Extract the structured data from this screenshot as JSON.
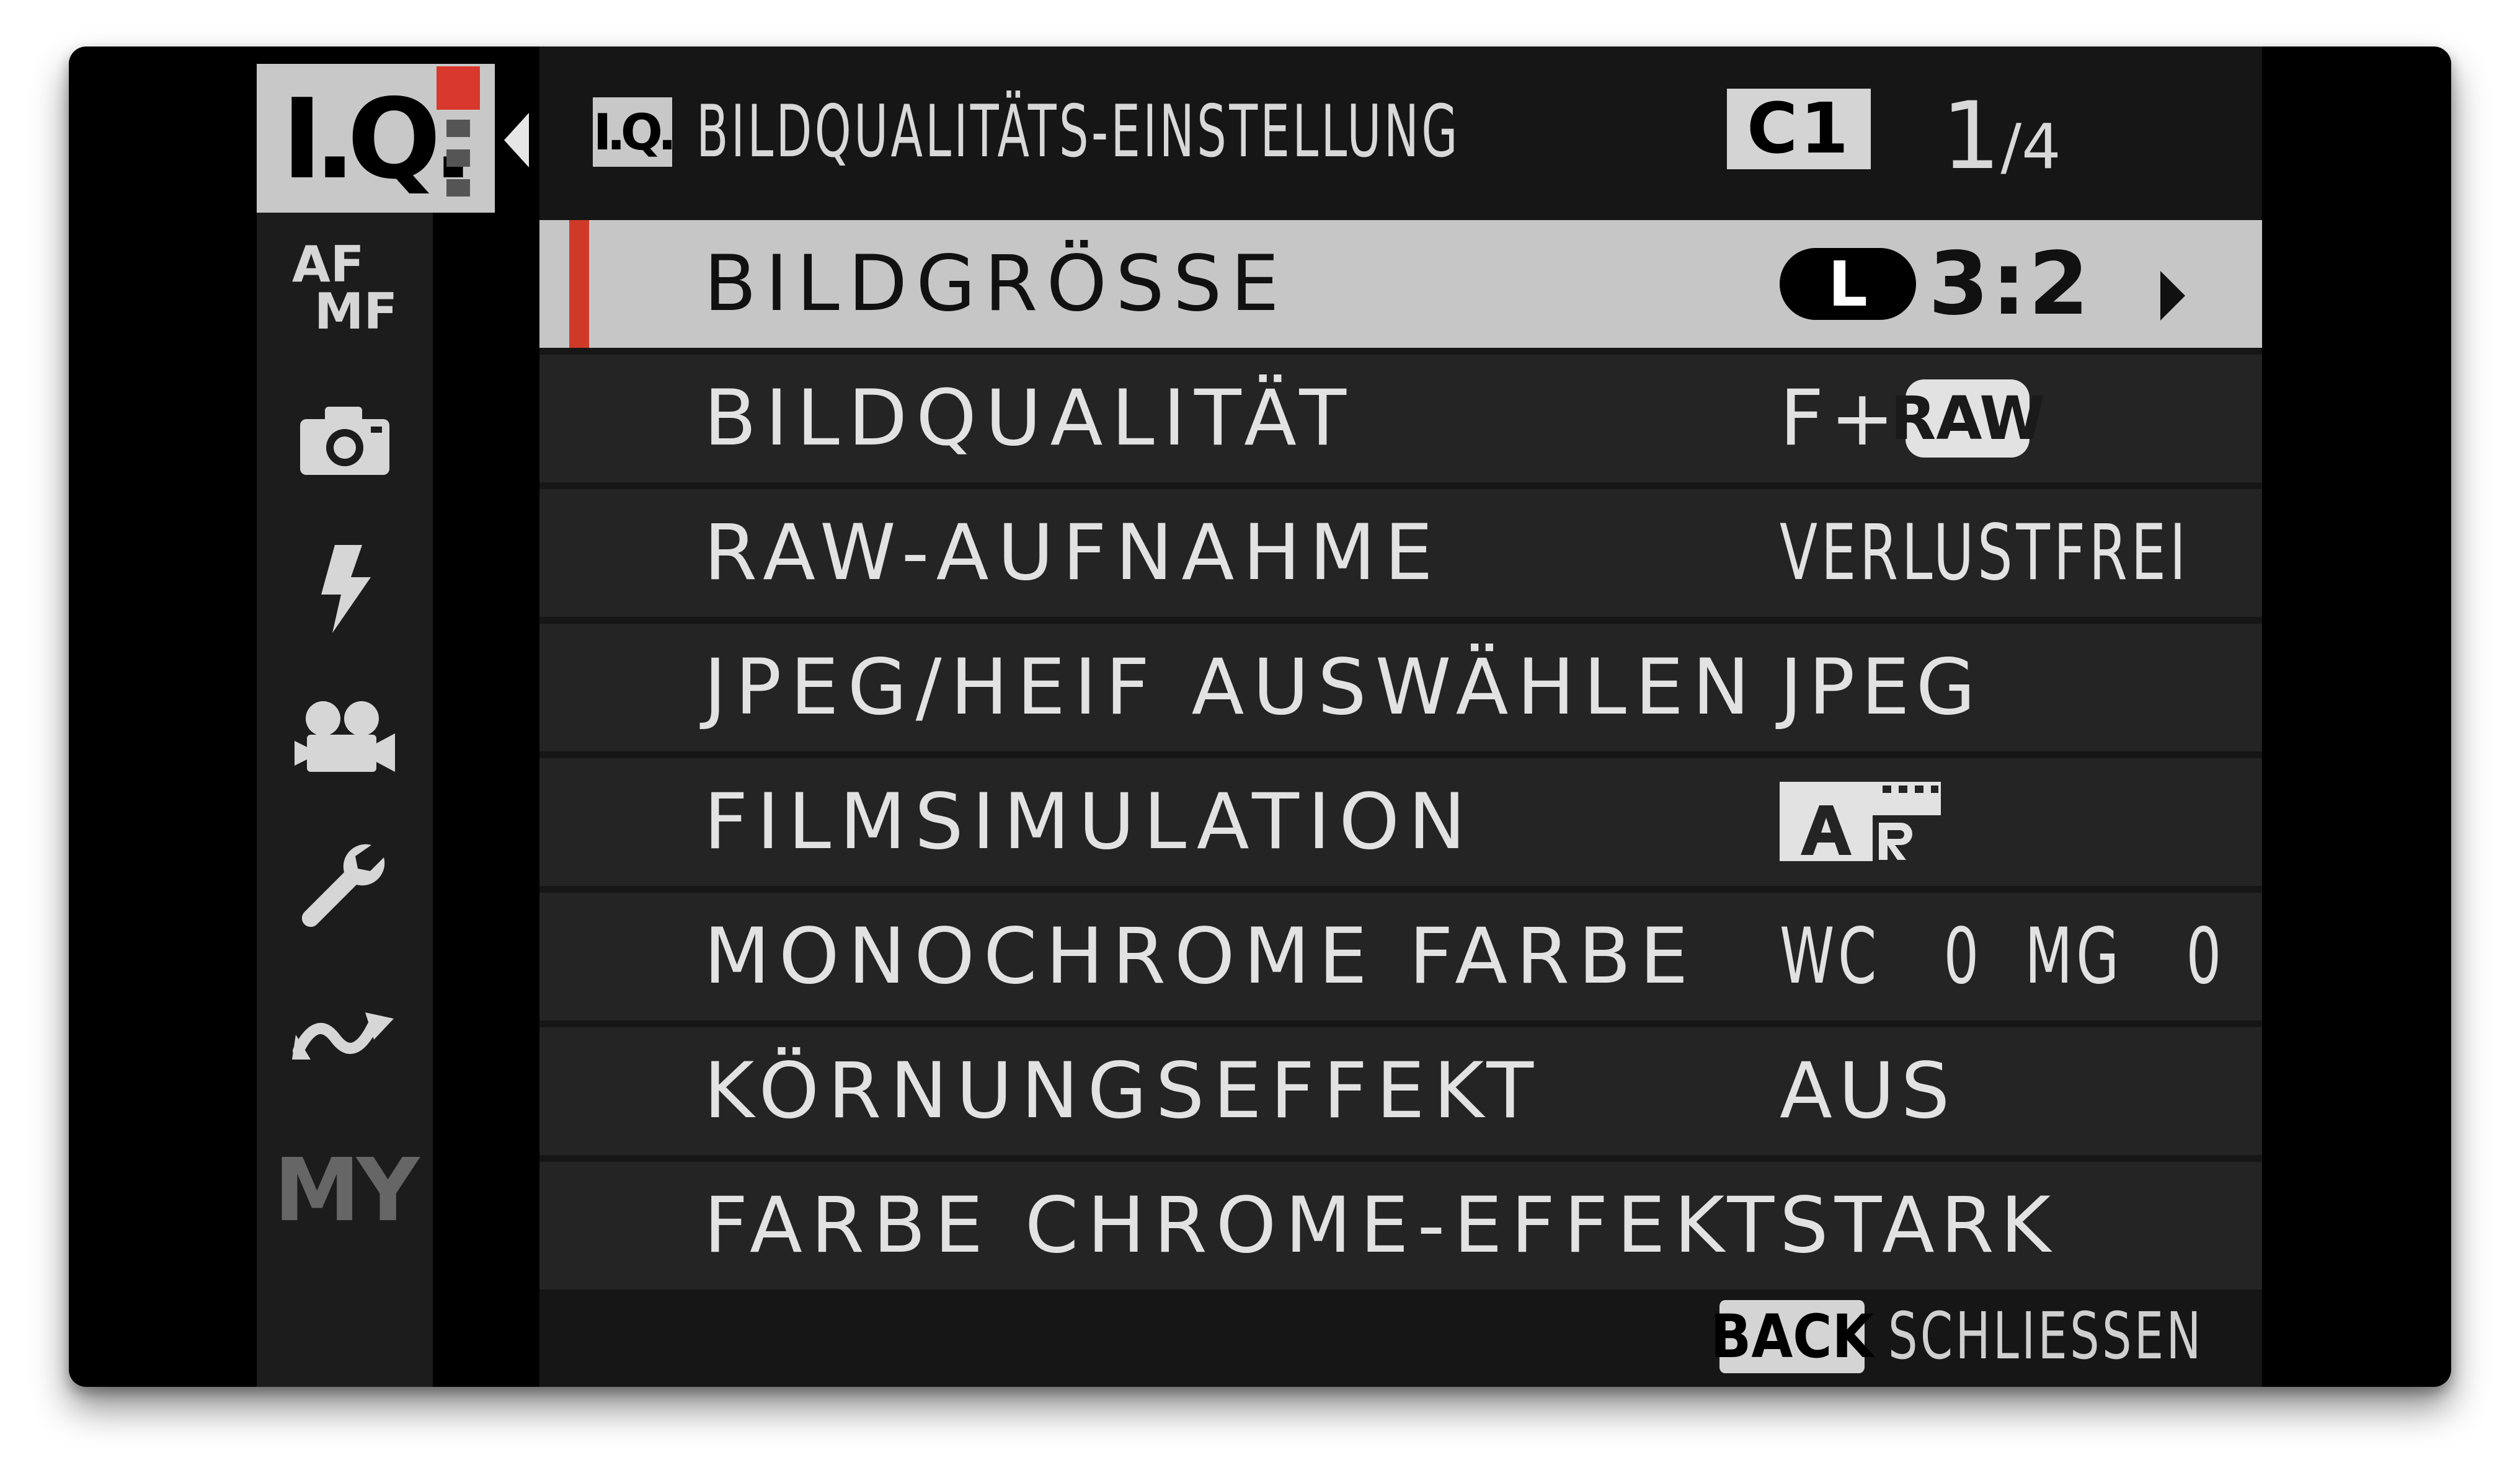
{
  "rail": {
    "active_label": "I.Q.",
    "items": [
      {
        "icon": "af-mf-icon",
        "af": "AF",
        "mf": "MF"
      },
      {
        "icon": "camera-icon"
      },
      {
        "icon": "flash-icon"
      },
      {
        "icon": "movie-camera-icon"
      },
      {
        "icon": "wrench-icon"
      },
      {
        "icon": "connection-icon"
      },
      {
        "icon": "my-menu-icon",
        "label": "MY"
      }
    ]
  },
  "header": {
    "icon_label": "I.Q.",
    "title": "BILDQUALITÄTS-EINSTELLUNG",
    "slot": "C1",
    "page_current": "1",
    "page_total": "/4"
  },
  "rows": [
    {
      "label": "BILDGRÖSSE",
      "size_badge": "L",
      "value": "3:2",
      "selected": true
    },
    {
      "label": "BILDQUALITÄT",
      "value": "F+",
      "badge": "RAW"
    },
    {
      "label": "RAW-AUFNAHME",
      "value": "VERLUSTFREI"
    },
    {
      "label": "JPEG/HEIF AUSWÄHLEN",
      "value": "JPEG"
    },
    {
      "label": "FILMSIMULATION",
      "icon": "film-simulation-acros-r-icon"
    },
    {
      "label": "MONOCHROME FARBE",
      "value": "WC   0  MG   0"
    },
    {
      "label": "KÖRNUNGSEFFEKT",
      "value": "AUS"
    },
    {
      "label": "FARBE CHROME-EFFEKT",
      "value": "STARK"
    }
  ],
  "footer": {
    "back_label": "BACK",
    "action": "SCHLIESSEN"
  },
  "colors": {
    "accent_red": "#cf3a28",
    "selected_row": "#c6c6c6",
    "row_bg": "#242424"
  }
}
